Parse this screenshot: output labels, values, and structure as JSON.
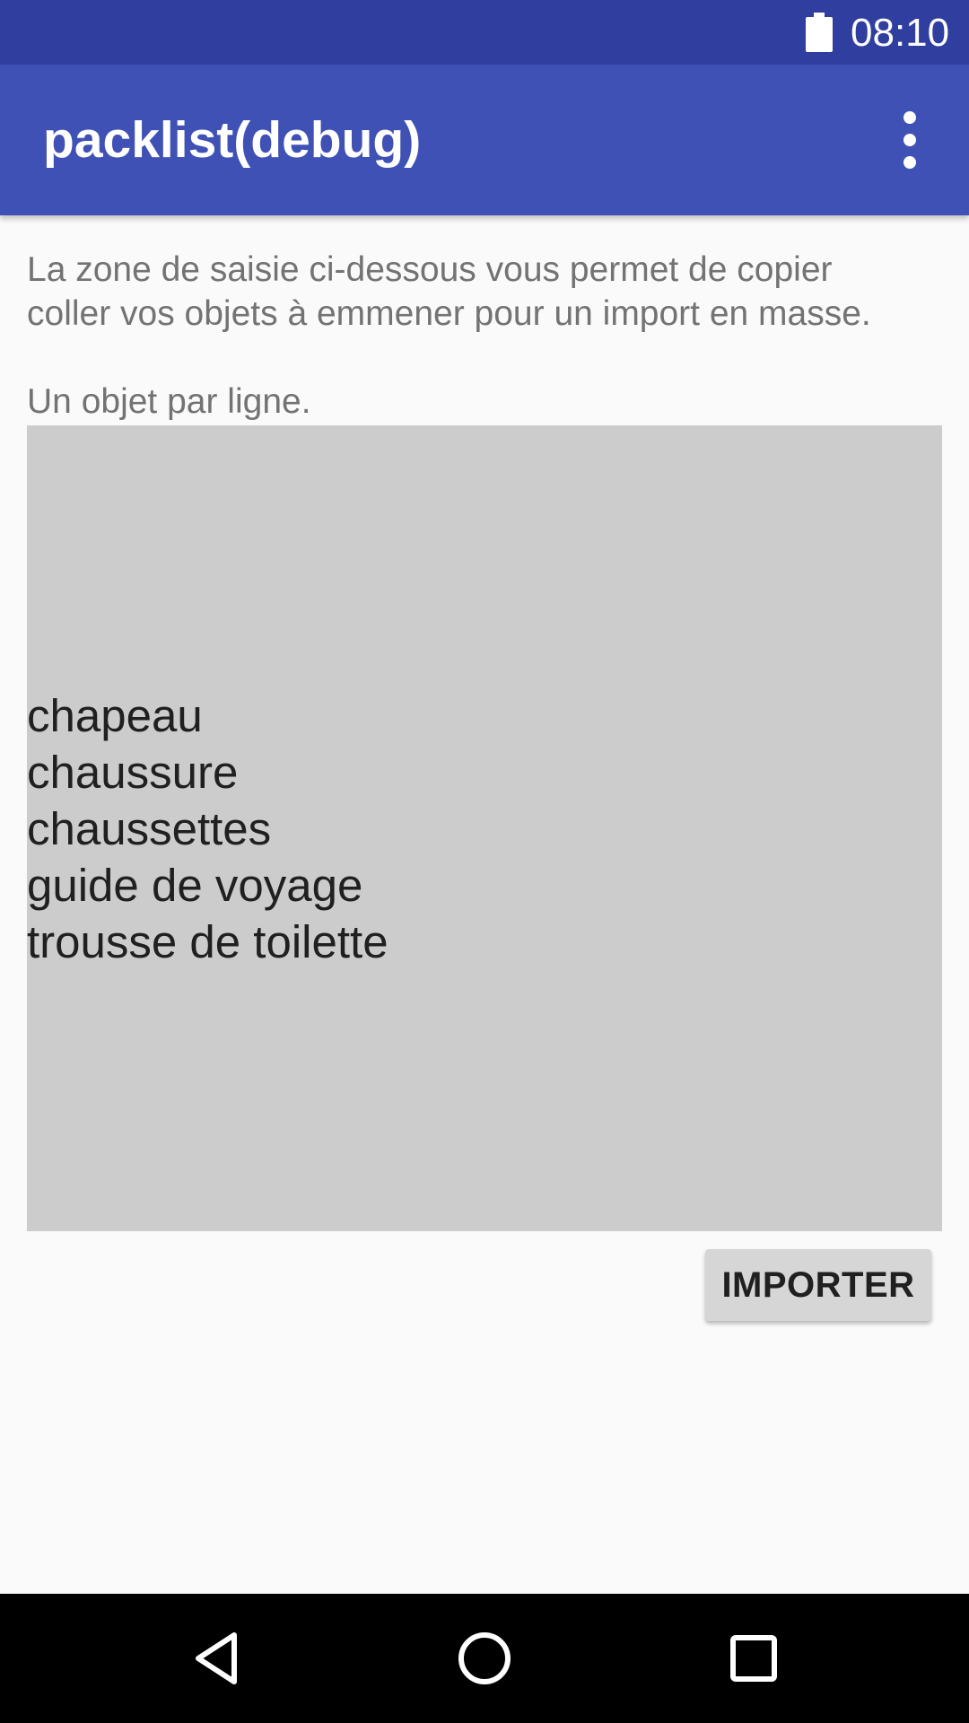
{
  "status_bar": {
    "time": "08:10",
    "icons": [
      "battery-icon"
    ],
    "background_color": "#303f9f"
  },
  "app_bar": {
    "title": "packlist(debug)",
    "menu_icon": "more-vert-icon",
    "background_color": "#3f51b5"
  },
  "main": {
    "description": "La zone de saisie ci-dessous vous permet de copier\ncoller vos objets à emmener pour un import en masse.\n\nUn objet par ligne.",
    "import_area": {
      "lines": [
        "chapeau",
        "chaussure",
        "chaussettes",
        "guide de voyage",
        "trousse de toilette"
      ],
      "background_color": "#cccccc"
    },
    "import_button_label": "IMPORTER"
  },
  "nav_bar": {
    "buttons": [
      "back-icon",
      "home-icon",
      "recents-icon"
    ]
  }
}
